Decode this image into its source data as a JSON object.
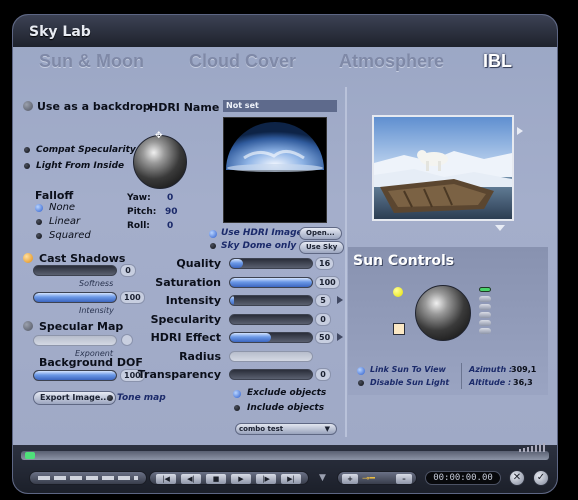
{
  "window": {
    "title": "Sky Lab"
  },
  "tabs": [
    {
      "label": "Sun & Moon"
    },
    {
      "label": "Cloud Cover"
    },
    {
      "label": "Atmosphere"
    },
    {
      "label": "IBL",
      "active": true
    }
  ],
  "ibl": {
    "use_backdrop_label": "Use as a backdrop",
    "hdri_name_label": "HDRI Name",
    "hdri_name_value": "Not set",
    "compat_specularity_label": "Compat Specularity",
    "light_from_inside_label": "Light From Inside",
    "falloff": {
      "label": "Falloff",
      "options": [
        "None",
        "Linear",
        "Squared"
      ],
      "selected": "None"
    },
    "rotation": {
      "yaw_label": "Yaw:",
      "yaw_value": "0",
      "pitch_label": "Pitch:",
      "pitch_value": "90",
      "roll_label": "Roll:",
      "roll_value": "0"
    },
    "use_hdri_image_label": "Use HDRI Image",
    "sky_dome_only_label": "Sky Dome only",
    "open_button": "Open...",
    "use_sky_button": "Use Sky",
    "cast_shadows": {
      "label": "Cast Shadows",
      "softness_label": "Softness",
      "softness_value": "0",
      "intensity_label": "Intensity",
      "intensity_value": "100",
      "intensity_fraction": 1.0
    },
    "specular_map": {
      "label": "Specular Map",
      "exponent_label": "Exponent"
    },
    "background_dof": {
      "label": "Background DOF",
      "value": "100",
      "fraction": 1.0
    },
    "export_image_button": "Export Image...",
    "tone_map_label": "Tone map",
    "params": [
      {
        "label": "Quality",
        "value": "16",
        "fraction": 0.16,
        "arrow": false,
        "disabled": false
      },
      {
        "label": "Saturation",
        "value": "100",
        "fraction": 1.0,
        "arrow": false,
        "disabled": false
      },
      {
        "label": "Intensity",
        "value": "5",
        "fraction": 0.05,
        "arrow": true,
        "disabled": false
      },
      {
        "label": "Specularity",
        "value": "0",
        "fraction": 0.0,
        "arrow": false,
        "disabled": false
      },
      {
        "label": "HDRI Effect",
        "value": "50",
        "fraction": 0.5,
        "arrow": true,
        "disabled": false
      },
      {
        "label": "Radius",
        "value": "",
        "fraction": 0.0,
        "arrow": false,
        "disabled": true
      },
      {
        "label": "Transparency",
        "value": "0",
        "fraction": 0.0,
        "arrow": false,
        "disabled": false
      }
    ],
    "exclude_objects_label": "Exclude objects",
    "include_objects_label": "Include objects",
    "combo_value": "combo test"
  },
  "sun_controls": {
    "title": "Sun Controls",
    "link_sun_to_view_label": "Link Sun To View",
    "disable_sun_light_label": "Disable Sun Light",
    "azimuth_label": "Azimuth :",
    "azimuth_value": "309,1",
    "altitude_label": "Altitude :",
    "altitude_value": "36,3"
  },
  "playback": {
    "time": "00:00:00.00",
    "controls": [
      "first-frame",
      "prev-key",
      "stop",
      "play",
      "next-key",
      "last-frame"
    ],
    "add_key_label": "+",
    "remove_key_label": "–"
  },
  "colors": {
    "accent_blue": "#3c66c0",
    "panel": "#9ea8c5",
    "title_bar": "#1e222c",
    "orange_indicator": "#e08a10"
  }
}
